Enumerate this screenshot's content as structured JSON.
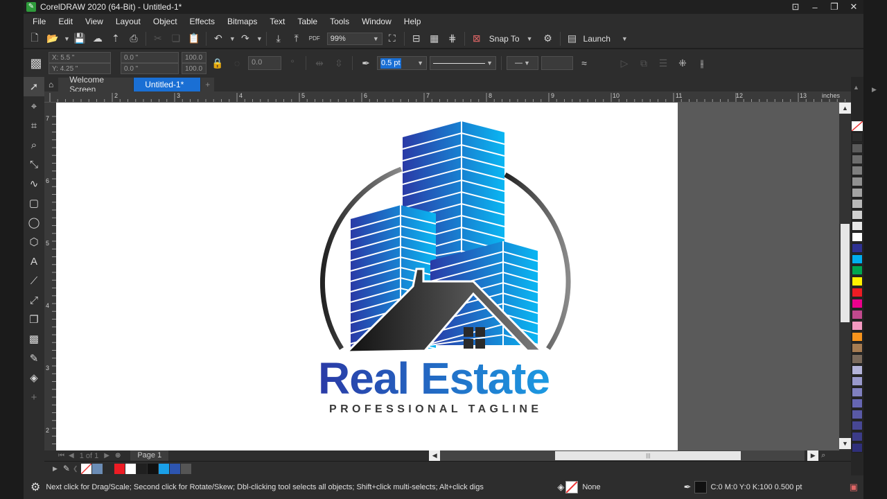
{
  "window": {
    "title": "CorelDRAW 2020 (64-Bit) - Untitled-1*"
  },
  "menu": [
    "File",
    "Edit",
    "View",
    "Layout",
    "Object",
    "Effects",
    "Bitmaps",
    "Text",
    "Table",
    "Tools",
    "Window",
    "Help"
  ],
  "toolbar": {
    "zoom": "99%",
    "snap_label": "Snap To",
    "launch_label": "Launch"
  },
  "propbar": {
    "x": "5.5 \"",
    "y": "4.25 \"",
    "w": "0.0 \"",
    "h": "0.0 \"",
    "scale_x": "100.0",
    "scale_y": "100.0",
    "angle": "0.0",
    "outline_width": "0.5 pt"
  },
  "tabs": [
    {
      "label": "Welcome Screen"
    },
    {
      "label": "Untitled-1*"
    }
  ],
  "ruler": {
    "units": "inches",
    "h_ticks": [
      "2",
      "3",
      "4",
      "5",
      "6",
      "7",
      "8",
      "9",
      "10",
      "11",
      "12",
      "13"
    ],
    "v_ticks": [
      "7",
      "6",
      "5",
      "4",
      "3",
      "2"
    ]
  },
  "logo": {
    "title": "Real Estate",
    "tagline": "PROFESSIONAL TAGLINE"
  },
  "pagebar": {
    "counter": "1 of 1",
    "page_tab": "Page 1"
  },
  "status": {
    "hint": "Next click for Drag/Scale; Second click for Rotate/Skew; Dbl-clicking tool selects all objects; Shift+click multi-selects; Alt+click digs",
    "fill": "None",
    "outline": "C:0 M:0 Y:0 K:100  0.500 pt"
  },
  "colors": {
    "accent": "#1a6fd4",
    "palette": [
      "#2b2b2b",
      "#5b5b5b",
      "#6d6d6d",
      "#7f7f7f",
      "#919191",
      "#a3a3a3",
      "#b8b8b8",
      "#cfcfcf",
      "#e8e8e8",
      "#ffffff",
      "#2e3192",
      "#00aeef",
      "#00a651",
      "#fff200",
      "#ed1c24",
      "#ec008c",
      "#c1498e",
      "#f49ac1",
      "#f7941d",
      "#a67c52",
      "#7a6a5c",
      "#b3b3d9",
      "#9999cc",
      "#8080bf",
      "#6666b3",
      "#5959a6",
      "#474794",
      "#3c3c88",
      "#2f2f7a"
    ],
    "doc_palette": [
      "#6b8cb5",
      "#2b2b2b",
      "#ed1c24",
      "#ffffff",
      "#202020",
      "#111111",
      "#1aa0e8",
      "#2d55b0",
      "#555555"
    ]
  }
}
